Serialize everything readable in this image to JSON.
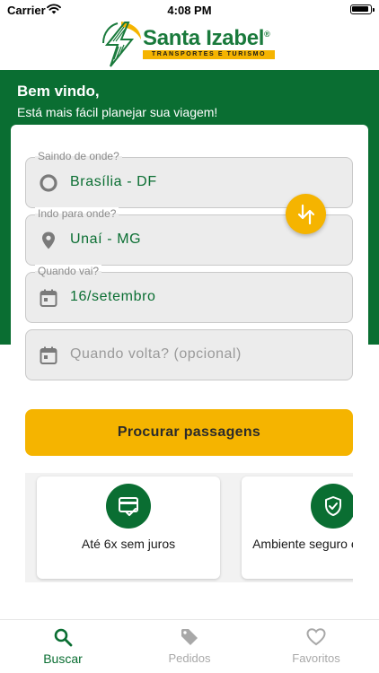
{
  "status_bar": {
    "carrier": "Carrier",
    "time": "4:08 PM"
  },
  "brand": {
    "name": "Santa Izabel",
    "registered": "®",
    "tagline": "TRANSPORTES E TURISMO"
  },
  "welcome": {
    "title": "Bem vindo,",
    "subtitle": "Está mais fácil planejar sua viagem!"
  },
  "search": {
    "origin": {
      "label": "Saindo de onde?",
      "value": "Brasília - DF",
      "icon": "radio-circle-icon"
    },
    "destination": {
      "label": "Indo para onde?",
      "value": "Unaí - MG",
      "icon": "map-pin-icon"
    },
    "departure": {
      "label": "Quando vai?",
      "value": "16/setembro",
      "icon": "calendar-icon"
    },
    "return": {
      "placeholder": "Quando volta? (opcional)",
      "icon": "calendar-icon"
    },
    "swap_icon": "swap-arrows-icon",
    "submit_label": "Procurar passagens"
  },
  "benefits": [
    {
      "text": "Até 6x sem juros",
      "icon": "credit-card-check-icon"
    },
    {
      "text": "Ambiente seguro e garantido",
      "icon": "shield-check-icon"
    }
  ],
  "tabs": [
    {
      "label": "Buscar",
      "icon": "search-icon",
      "active": true
    },
    {
      "label": "Pedidos",
      "icon": "tag-icon",
      "active": false
    },
    {
      "label": "Favoritos",
      "icon": "heart-icon",
      "active": false
    }
  ],
  "colors": {
    "brand_green": "#0a6e32",
    "accent_yellow": "#f5b400",
    "muted_gray": "#a8a8a8"
  }
}
